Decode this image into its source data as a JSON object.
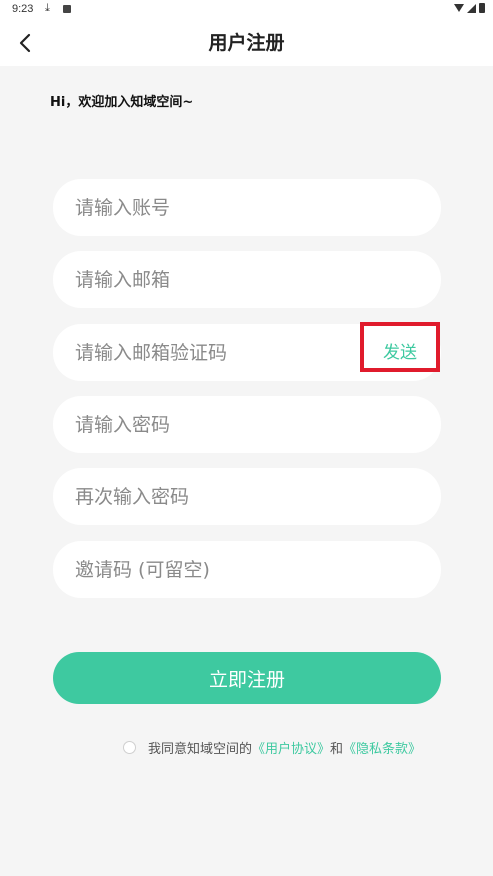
{
  "status_bar": {
    "time": "9:23",
    "download_icon": "download-icon",
    "notification_icon": "a-icon"
  },
  "app_bar": {
    "title": "用户注册",
    "back_icon": "chevron-left-icon"
  },
  "welcome_text": "Hi，欢迎加入知域空间~",
  "form": {
    "account_placeholder": "请输入账号",
    "email_placeholder": "请输入邮箱",
    "email_code_placeholder": "请输入邮箱验证码",
    "send_label": "发送",
    "password_placeholder": "请输入密码",
    "password_confirm_placeholder": "再次输入密码",
    "invite_placeholder": "邀请码 (可留空)"
  },
  "register_button": "立即注册",
  "agreement": {
    "prefix": "我同意知域空间的",
    "user_agreement": "《用户协议》",
    "and": "和",
    "privacy_policy": "《隐私条款》"
  },
  "colors": {
    "accent": "#3ec9a0",
    "highlight_box": "#e01b2c",
    "background": "#f5f5f5"
  }
}
